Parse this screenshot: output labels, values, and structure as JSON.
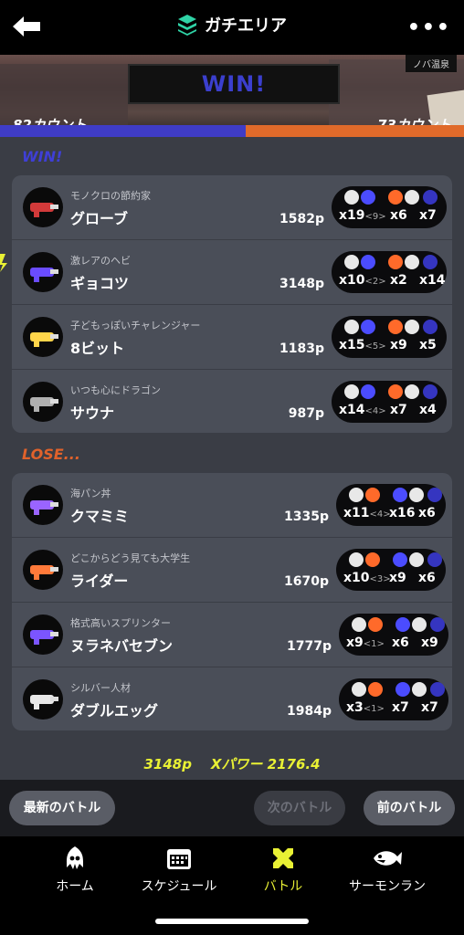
{
  "header": {
    "title": "ガチエリア",
    "back_icon": "back-arrow-icon",
    "more_icon": "more-dots-icon"
  },
  "banner": {
    "result": "WIN!",
    "tag": "ノバ温泉",
    "left_count": "82カウント",
    "right_count": "73カウント"
  },
  "score": {
    "left_fraction": 0.53
  },
  "win_label": "WIN!",
  "lose_label": "LOSE...",
  "win_team": [
    {
      "title": "モノクロの節約家",
      "name": "グローブ",
      "points": "1582p",
      "kills": "x19",
      "assists": "<9>",
      "deaths": "x6",
      "specials": "x7"
    },
    {
      "title": "激レアのヘビ",
      "name": "ギョコツ",
      "points": "3148p",
      "kills": "x10",
      "assists": "<2>",
      "deaths": "x2",
      "specials": "x14"
    },
    {
      "title": "子どもっぽいチャレンジャー",
      "name": "8ビット",
      "points": "1183p",
      "kills": "x15",
      "assists": "<5>",
      "deaths": "x9",
      "specials": "x5"
    },
    {
      "title": "いつも心にドラゴン",
      "name": "サウナ",
      "points": "987p",
      "kills": "x14",
      "assists": "<4>",
      "deaths": "x7",
      "specials": "x4"
    }
  ],
  "lose_team": [
    {
      "title": "海パン丼",
      "name": "クマミミ",
      "points": "1335p",
      "kills": "x11",
      "assists": "<4>",
      "deaths": "x16",
      "specials": "x6"
    },
    {
      "title": "どこからどう見ても大学生",
      "name": "ライダー",
      "points": "1670p",
      "kills": "x10",
      "assists": "<3>",
      "deaths": "x9",
      "specials": "x6"
    },
    {
      "title": "格式高いスプリンター",
      "name": "ヌラネバセブン",
      "points": "1777p",
      "kills": "x9",
      "assists": "<1>",
      "deaths": "x6",
      "specials": "x9"
    },
    {
      "title": "シルバー人材",
      "name": "ダブルエッグ",
      "points": "1984p",
      "kills": "x3",
      "assists": "<1>",
      "deaths": "x7",
      "specials": "x7"
    }
  ],
  "summary": {
    "points": "3148p",
    "xpower": "Xパワー 2176.4"
  },
  "nav": {
    "latest": "最新のバトル",
    "next": "次のバトル",
    "prev": "前のバトル"
  },
  "tabs": {
    "home": "ホーム",
    "schedule": "スケジュール",
    "battle": "バトル",
    "salmon": "サーモンラン"
  },
  "colors": {
    "accent": "#e9f134",
    "win": "#3f3fd6",
    "lose": "#e0622b"
  }
}
